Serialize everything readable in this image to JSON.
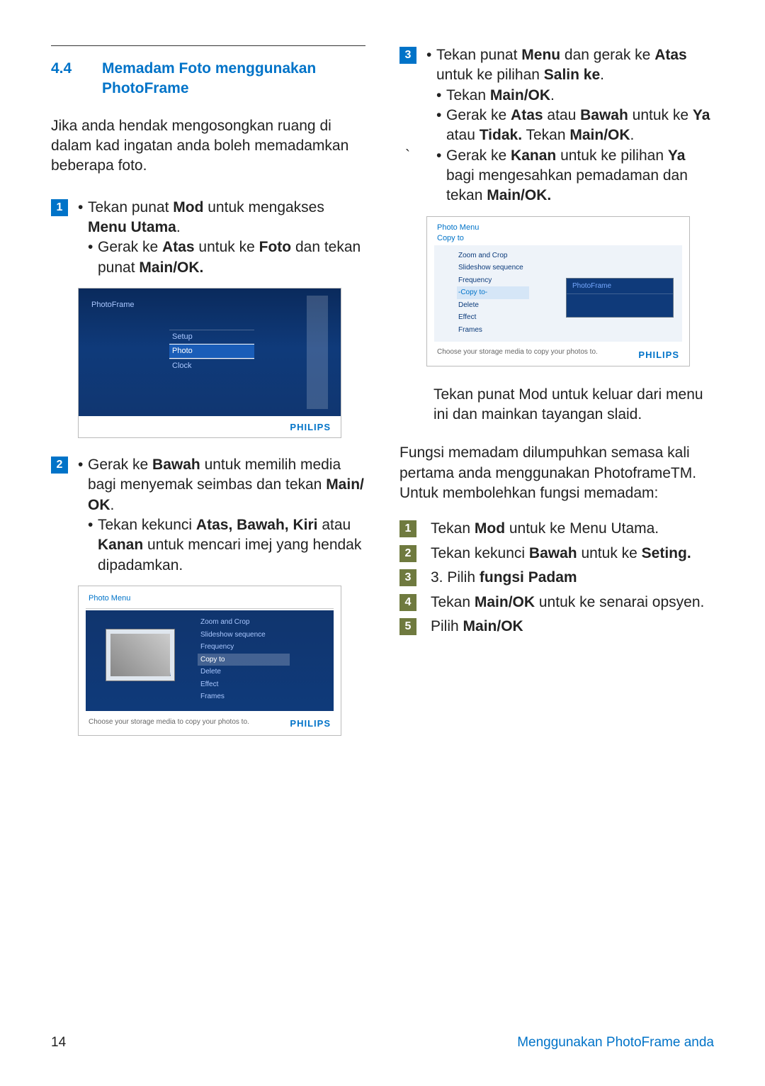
{
  "header": {
    "section_number": "4.4",
    "section_title": "Memadam Foto menggunakan PhotoFrame"
  },
  "intro": "Jika anda hendak mengosongkan ruang di dalam kad ingatan anda boleh memadamkan beberapa foto.",
  "left": {
    "s1a_pre": "Tekan punat ",
    "s1a_b1": "Mod",
    "s1a_mid": " untuk mengakses ",
    "s1a_b2": "Menu Utama",
    "s1a_post": ".",
    "s1b_pre": "Gerak ke ",
    "s1b_b1": "Atas",
    "s1b_mid": " untuk ke ",
    "s1b_b2": "Foto",
    "s1b_mid2": " dan tekan punat ",
    "s1b_b3": "Main/OK.",
    "s2a_pre": "Gerak ke ",
    "s2a_b1": "Bawah",
    "s2a_mid": " untuk memilih media bagi menyemak seimbas dan tekan ",
    "s2a_b2": "Main/ OK",
    "s2a_post": ".",
    "s2b_pre": "Tekan kekunci ",
    "s2b_b1": "Atas, Bawah, Kiri",
    "s2b_mid": " atau ",
    "s2b_b2": "Kanan",
    "s2b_post": " untuk mencari imej yang hendak dipadamkan."
  },
  "right": {
    "s3a_pre": "Tekan punat ",
    "s3a_b1": "Menu",
    "s3a_mid": " dan gerak ke ",
    "s3a_b2": "Atas",
    "s3a_mid2": " untuk ke pilihan ",
    "s3a_b3": "Salin ke",
    "s3a_post": ".",
    "s3b_pre": "Tekan ",
    "s3b_b1": "Main/OK",
    "s3b_post": ".",
    "s3c_pre": "Gerak ke ",
    "s3c_b1": "Atas",
    "s3c_mid": " atau ",
    "s3c_b2": "Bawah",
    "s3c_mid2": " untuk ke ",
    "s3c_b3": "Ya",
    "s3c_mid3": " atau ",
    "s3c_b4": "Tidak.",
    "s3c_mid4": " Tekan ",
    "s3c_b5": "Main/OK",
    "s3c_post": ".",
    "s3d_pre": "Gerak ke ",
    "s3d_b1": "Kanan",
    "s3d_mid": " untuk ke pilihan ",
    "s3d_b2": "Ya",
    "s3d_mid2": " bagi mengesahkan pemadaman dan tekan ",
    "s3d_b3": "Main/OK.",
    "note": "Tekan punat Mod untuk keluar dari menu ini dan mainkan tayangan slaid.",
    "para": "Fungsi memadam dilumpuhkan semasa kali pertama anda menggunakan  PhotoframeTM. Untuk membolehkan fungsi memadam:",
    "e1_pre": "Tekan ",
    "e1_b": "Mod",
    "e1_post": " untuk ke Menu Utama.",
    "e2_pre": "Tekan kekunci ",
    "e2_b": "Bawah",
    "e2_mid": " untuk ke ",
    "e2_b2": "Seting.",
    "e3_pre": "3. Pilih ",
    "e3_b": "fungsi Padam",
    "e4_pre": "Tekan ",
    "e4_b": "Main/OK",
    "e4_post": " untuk ke senarai opsyen.",
    "e5_pre": "Pilih ",
    "e5_b": "Main/OK"
  },
  "mockA": {
    "label": "PhotoFrame",
    "items": [
      "Setup",
      "Photo",
      "Clock"
    ],
    "brand": "PHILIPS"
  },
  "mockB": {
    "title": "Photo Menu",
    "thumb_caption": "PHILIPS",
    "items": [
      "Zoom and Crop",
      "Slideshow sequence",
      "Frequency",
      "Copy to",
      "Delete",
      "Effect",
      "Frames"
    ],
    "hint": "Choose your storage media to copy your photos to.",
    "brand": "PHILIPS"
  },
  "mockC": {
    "title1": "Photo Menu",
    "title2": "Copy to",
    "items": [
      "Zoom and Crop",
      "Slideshow sequence",
      "Frequency",
      "-Copy to-",
      "Delete",
      "Effect",
      "Frames"
    ],
    "popup": "PhotoFrame",
    "hint": "Choose your storage media to copy your photos to.",
    "brand": "PHILIPS"
  },
  "badges": {
    "n1": "1",
    "n2": "2",
    "n3": "3",
    "n4": "4",
    "n5": "5"
  },
  "footer": {
    "page": "14",
    "section": "Menggunakan PhotoFrame anda"
  }
}
